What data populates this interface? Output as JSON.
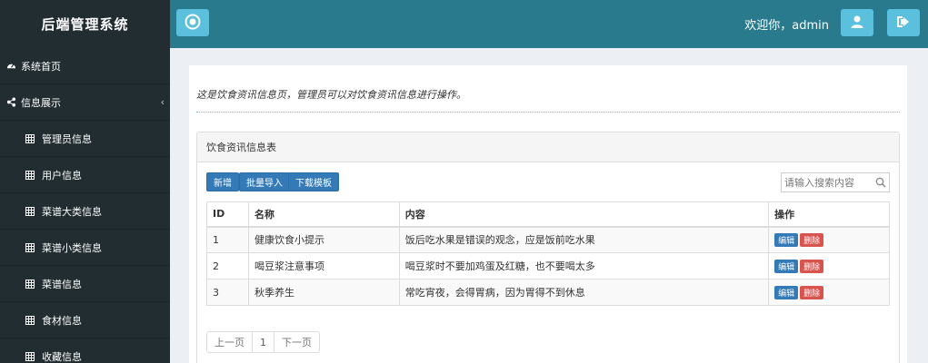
{
  "app": {
    "title": "后端管理系统"
  },
  "header": {
    "welcome": "欢迎你，admin"
  },
  "sidebar": {
    "items": [
      {
        "label": "系统首页",
        "icon": "dashboard-icon",
        "type": "top"
      },
      {
        "label": "信息展示",
        "icon": "share-icon",
        "type": "top",
        "expandable": true,
        "caret": "‹"
      },
      {
        "label": "管理员信息",
        "icon": "table-icon",
        "type": "sub"
      },
      {
        "label": "用户信息",
        "icon": "table-icon",
        "type": "sub"
      },
      {
        "label": "菜谱大类信息",
        "icon": "table-icon",
        "type": "sub"
      },
      {
        "label": "菜谱小类信息",
        "icon": "table-icon",
        "type": "sub"
      },
      {
        "label": "菜谱信息",
        "icon": "table-icon",
        "type": "sub"
      },
      {
        "label": "食材信息",
        "icon": "table-icon",
        "type": "sub"
      },
      {
        "label": "收藏信息",
        "icon": "table-icon",
        "type": "sub"
      }
    ]
  },
  "main": {
    "description": "这是饮食资讯信息页，管理员可以对饮食资讯信息进行操作。",
    "panel_title": "饮食资讯信息表",
    "buttons": {
      "add": "新增",
      "import": "批量导入",
      "download": "下载模板"
    },
    "search": {
      "placeholder": "请输入搜索内容",
      "value": ""
    },
    "table": {
      "headers": [
        "ID",
        "名称",
        "内容",
        "操作"
      ],
      "rows": [
        {
          "id": "1",
          "name": "健康饮食小提示",
          "content": "饭后吃水果是错误的观念，应是饭前吃水果",
          "edit": "编辑",
          "delete": "删除"
        },
        {
          "id": "2",
          "name": "喝豆浆注意事项",
          "content": "喝豆浆时不要加鸡蛋及红糖，也不要喝太多",
          "edit": "编辑",
          "delete": "删除"
        },
        {
          "id": "3",
          "name": "秋季养生",
          "content": "常吃宵夜，会得胃病，因为胃得不到休息",
          "edit": "编辑",
          "delete": "删除"
        }
      ]
    },
    "pagination": {
      "prev": "上一页",
      "current": "1",
      "next": "下一页"
    }
  },
  "colors": {
    "header": "#2a7a8d",
    "sidebar": "#222d32",
    "accent_button": "#5bc0de",
    "primary": "#337ab7",
    "danger": "#d9534f"
  }
}
